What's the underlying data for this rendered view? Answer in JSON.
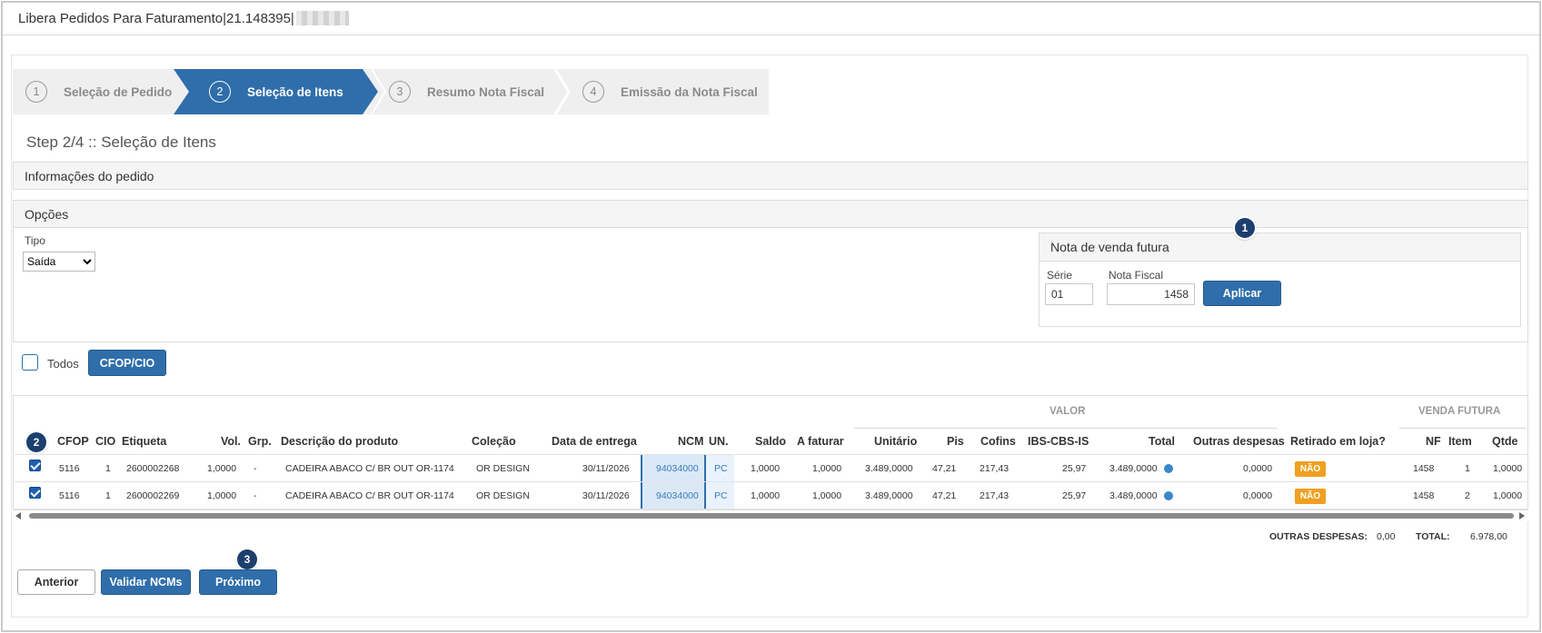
{
  "window": {
    "title": "Libera Pedidos Para Faturamento|21.148395|"
  },
  "wizard": {
    "steps": [
      {
        "num": "1",
        "label": "Seleção de Pedido"
      },
      {
        "num": "2",
        "label": "Seleção de Itens"
      },
      {
        "num": "3",
        "label": "Resumo Nota Fiscal"
      },
      {
        "num": "4",
        "label": "Emissão da Nota Fiscal"
      }
    ],
    "active_step": 2
  },
  "step_title": "Step 2/4 :: Seleção de Itens",
  "sections": {
    "info": "Informações do pedido",
    "options": "Opções"
  },
  "tipo": {
    "label": "Tipo",
    "value": "Saída"
  },
  "nota_venda_futura": {
    "title": "Nota de venda futura",
    "serie_label": "Série",
    "serie_value": "01",
    "nf_label": "Nota Fiscal",
    "nf_value": "1458",
    "apply_label": "Aplicar"
  },
  "todos_label": "Todos",
  "cfop_button": "CFOP/CIO",
  "badges": {
    "b1": "1",
    "b2": "2",
    "b3": "3"
  },
  "table": {
    "group_valor": "VALOR",
    "group_venda_futura": "VENDA FUTURA",
    "headers": {
      "cfop": "CFOP",
      "cio": "CIO",
      "etiqueta": "Etiqueta",
      "vol": "Vol.",
      "grp": "Grp.",
      "descricao": "Descrição do produto",
      "colecao": "Coleção",
      "data_entrega": "Data de entrega",
      "ncm": "NCM",
      "un": "UN.",
      "saldo": "Saldo",
      "a_faturar": "A faturar",
      "unitario": "Unitário",
      "pis": "Pis",
      "cofins": "Cofins",
      "ibs": "IBS-CBS-IS",
      "total": "Total",
      "outras": "Outras despesas",
      "retirado": "Retirado em loja?",
      "nf": "NF",
      "item": "Item",
      "qtde": "Qtde"
    },
    "rows": [
      {
        "checked": true,
        "cfop": "5116",
        "cio": "1",
        "etiqueta": "2600002268",
        "vol": "1,0000",
        "grp": "-",
        "descricao": "CADEIRA ABACO C/ BR OUT OR-1174",
        "colecao": "OR DESIGN",
        "data_entrega": "30/11/2026",
        "ncm": "94034000",
        "un": "PC",
        "saldo": "1,0000",
        "a_faturar": "1,0000",
        "unitario": "3.489,0000",
        "pis": "47,21",
        "cofins": "217,43",
        "ibs": "25,97",
        "total": "3.489,0000",
        "outras": "0,0000",
        "retirado": "NÃO",
        "nf": "1458",
        "item": "1",
        "qtde": "1,0000"
      },
      {
        "checked": true,
        "cfop": "5116",
        "cio": "1",
        "etiqueta": "2600002269",
        "vol": "1,0000",
        "grp": "-",
        "descricao": "CADEIRA ABACO C/ BR OUT OR-1174",
        "colecao": "OR DESIGN",
        "data_entrega": "30/11/2026",
        "ncm": "94034000",
        "un": "PC",
        "saldo": "1,0000",
        "a_faturar": "1,0000",
        "unitario": "3.489,0000",
        "pis": "47,21",
        "cofins": "217,43",
        "ibs": "25,97",
        "total": "3.489,0000",
        "outras": "0,0000",
        "retirado": "NÃO",
        "nf": "1458",
        "item": "2",
        "qtde": "1,0000"
      }
    ]
  },
  "totals": {
    "outras_label": "OUTRAS DESPESAS:",
    "outras_value": "0,00",
    "total_label": "TOTAL:",
    "total_value": "6.978,00"
  },
  "footer": {
    "anterior": "Anterior",
    "validar": "Validar NCMs",
    "proximo": "Próximo"
  },
  "colors": {
    "primary": "#2f6eaa",
    "badge": "#1c3f6e",
    "warning": "#f0a020"
  }
}
